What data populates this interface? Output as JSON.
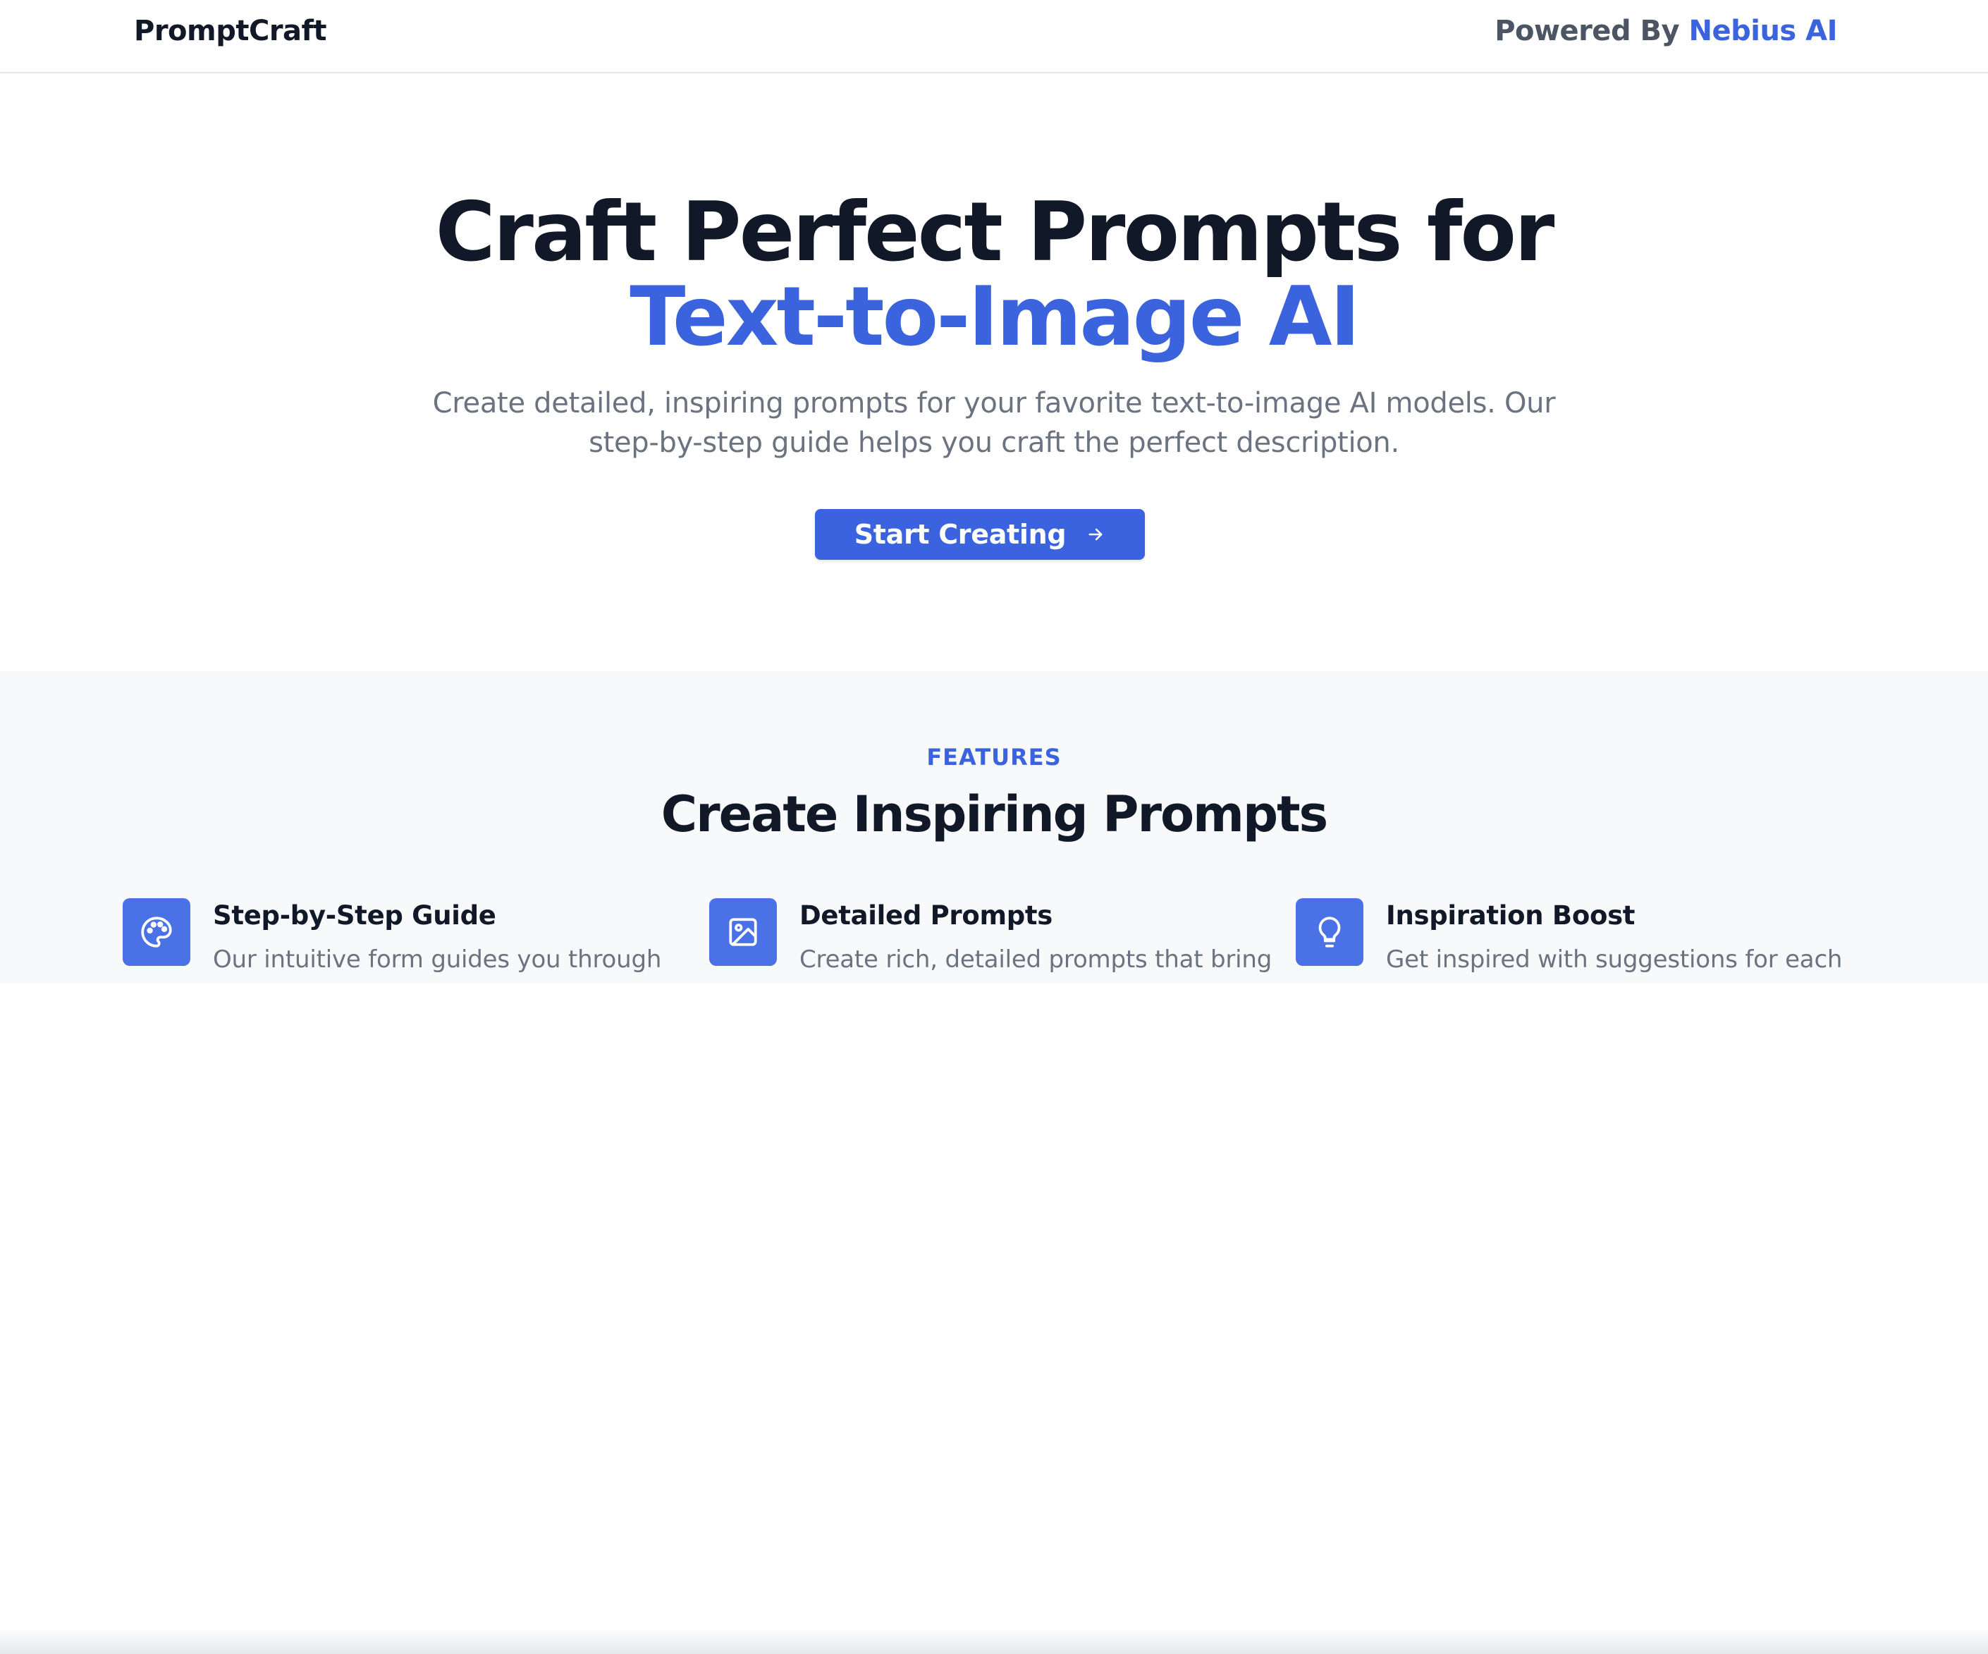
{
  "header": {
    "brand": "PromptCraft",
    "powered_prefix": "Powered By",
    "powered_link": "Nebius AI"
  },
  "hero": {
    "title_line1": "Craft Perfect Prompts for",
    "title_line2": "Text-to-Image AI",
    "subtitle": "Create detailed, inspiring prompts for your favorite text-to-image AI models. Our step-by-step guide helps you craft the perfect description.",
    "cta_label": "Start Creating",
    "cta_icon": "arrow-right-icon"
  },
  "features": {
    "eyebrow": "FEATURES",
    "title": "Create Inspiring Prompts",
    "items": [
      {
        "icon": "palette-icon",
        "title": "Step-by-Step Guide",
        "description": "Our intuitive form guides you through"
      },
      {
        "icon": "image-icon",
        "title": "Detailed Prompts",
        "description": "Create rich, detailed prompts that bring"
      },
      {
        "icon": "lightbulb-icon",
        "title": "Inspiration Boost",
        "description": "Get inspired with suggestions for each"
      }
    ]
  },
  "colors": {
    "accent": "#3b63dd",
    "heading": "#111827",
    "muted": "#6b7280",
    "features_bg": "#f8f9fb"
  }
}
